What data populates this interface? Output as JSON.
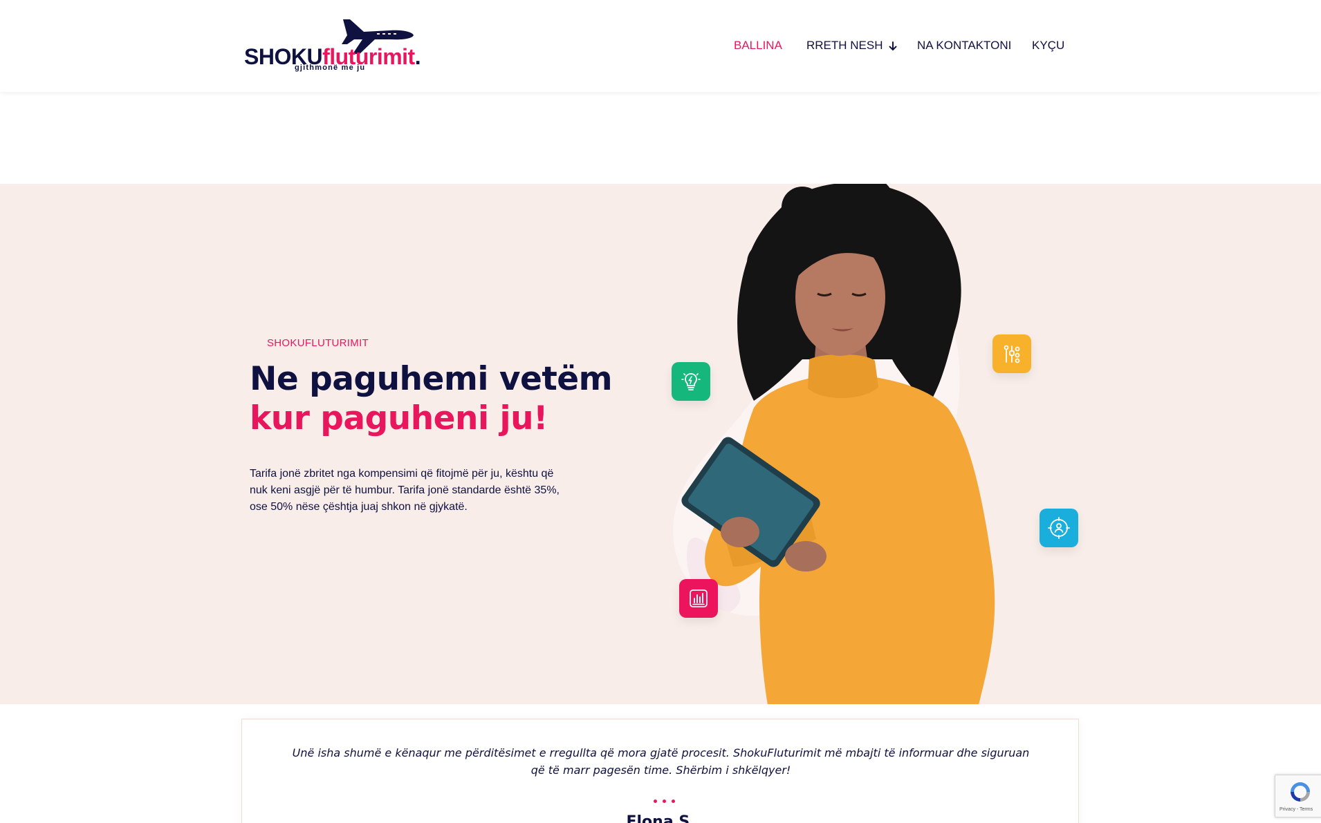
{
  "header": {
    "logo": {
      "brand_main": "SHOKU",
      "brand_accent": "fluturimit",
      "brand_dot": ".",
      "tagline": "gjithmonë me ju"
    },
    "nav": [
      {
        "label": "BALLINA",
        "active": true
      },
      {
        "label": "RRETH NESH",
        "active": false,
        "has_dropdown": true
      },
      {
        "label": "NA KONTAKTONI",
        "active": false
      },
      {
        "label": "KYÇU",
        "active": false
      }
    ]
  },
  "hero": {
    "eyebrow": "SHOKUFLUTURIMIT",
    "headline_line1": "Ne paguhemi vetëm",
    "headline_line2": "kur paguheni ju!",
    "body": "Tarifa jonë zbritet nga kompensimi që fitojmë për ju, kështu që nuk keni asgjë për të humbur. Tarifa jonë standarde është 35%, ose 50% nëse çështja juaj shkon në gjykatë.",
    "badges": [
      {
        "icon": "lightbulb-icon",
        "color": "#16b77d"
      },
      {
        "icon": "sliders-icon",
        "color": "#f7b12a"
      },
      {
        "icon": "user-target-icon",
        "color": "#1aaedd"
      },
      {
        "icon": "bar-chart-icon",
        "color": "#ec145c"
      }
    ]
  },
  "testimonial": {
    "quote": "Unë isha shumë e kënaqur me përditësimet e rregullta që mora gjatë procesit. ShokuFluturimit më mbajti të informuar dhe siguruan që të marr pagesën time. Shërbim i shkëlqyer!",
    "author": "Elona S."
  },
  "recaptcha": {
    "links": "Privacy - Terms"
  },
  "colors": {
    "navy": "#0f1140",
    "accent": "#e8175d",
    "hero_bg": "#f8ede9"
  }
}
